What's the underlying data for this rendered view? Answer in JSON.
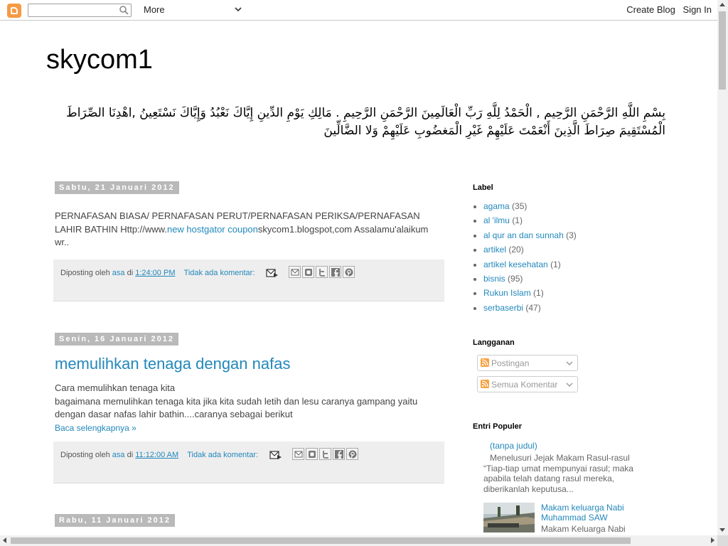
{
  "navbar": {
    "search_placeholder": "",
    "more_label": "More",
    "create_blog": "Create Blog",
    "sign_in": "Sign In"
  },
  "header": {
    "title": "skycom1",
    "description": "بِسْمِ اللَّهِ الرَّحْمَنِ الرَّحِيم , الْحَمْدُ لِلَّهِ رَبِّ الْعَالَمِينَ الرَّحْمَنِ الرَّحِيمِ . مَالِكِ يَوْمِ الدِّينِ إِيَّاكَ نَعْبُدُ وَإِيَّاكَ نَسْتَعِينُ ,اهْدِنَا الصِّرَاطَ الْمُسْتَقِيمَ صِرَاطَ الَّذِينَ أَنْعَمْتَ عَلَيْهِمْ غَيْرِ الْمَغضُوبِ عَلَيْهِمْ وَلا الضَّالِّينَ"
  },
  "posts": [
    {
      "date": "Sabtu, 21 Januari 2012",
      "body_prefix": "PERNAFASAN BIASA/ PERNAFASAN PERUT/PERNAFASAN PERIKSA/PERNAFASAN LAHIR BATHIN Http://www.",
      "body_link": "new hostgator coupon",
      "body_suffix": "skycom1.blogspot,com Assalamu'alaikum wr..",
      "footer_prefix": "Diposting oleh",
      "author": "asa",
      "at": "di",
      "time": "1:24:00 PM",
      "comments": "Tidak ada komentar:"
    },
    {
      "date": "Senin, 16 Januari 2012",
      "title": "memulihkan tenaga dengan nafas",
      "body_line1": "Cara memulihkan tenaga kita",
      "body_line2": "bagaimana memulihkan tenaga kita jika kita sudah letih dan lesu caranya gampang yaitu dengan dasar nafas lahir bathin....caranya sebagai berikut",
      "read_more": "Baca selengkapnya »",
      "footer_prefix": "Diposting oleh",
      "author": "asa",
      "at": "di",
      "time": "11:12:00 AM",
      "comments": "Tidak ada komentar:"
    },
    {
      "date": "Rabu, 11 Januari 2012"
    }
  ],
  "sidebar": {
    "labels_title": "Label",
    "labels": [
      {
        "name": "agama",
        "count": "(35)"
      },
      {
        "name": "al 'ilmu",
        "count": "(1)"
      },
      {
        "name": "al qur an dan sunnah",
        "count": "(3)"
      },
      {
        "name": "artikel",
        "count": "(20)"
      },
      {
        "name": "artikel kesehatan",
        "count": "(1)"
      },
      {
        "name": "bisnis",
        "count": "(95)"
      },
      {
        "name": "Rukun Islam",
        "count": "(1)"
      },
      {
        "name": "serbaserbi",
        "count": "(47)"
      }
    ],
    "subscribe_title": "Langganan",
    "subscribe_posts": "Postingan",
    "subscribe_comments": "Semua Komentar",
    "popular_title": "Entri Populer",
    "popular": [
      {
        "title": "(tanpa judul)",
        "snippet": "Menelusuri Jejak Makam Rasul-rasul “Tiap-tiap umat mempunyai rasul; maka apabila telah datang rasul mereka, diberikanlah keputusa..."
      },
      {
        "title": "Makam keluarga Nabi Muhammad SAW",
        "snippet": "Makam Keluarga Nabi"
      }
    ]
  },
  "colors": {
    "link": "#2288bb",
    "date_bg": "#b9b9b9",
    "footer_bg": "#eeeeee",
    "logo": "#f59a45"
  }
}
